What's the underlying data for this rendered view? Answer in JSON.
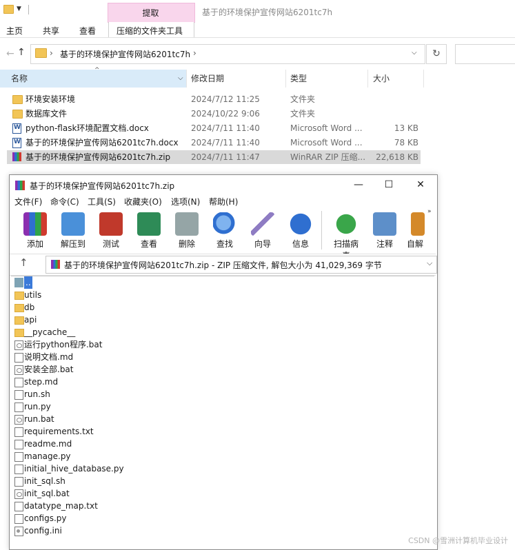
{
  "explorer": {
    "window_title": "基于的环境保护宣传网站6201tc7h",
    "context_tab": "提取",
    "tabs": [
      "主页",
      "共享",
      "查看",
      "压缩的文件夹工具"
    ],
    "address": "基于的环境保护宣传网站6201tc7h",
    "columns": [
      "名称",
      "修改日期",
      "类型",
      "大小"
    ],
    "files": [
      {
        "name": "环境安装环境",
        "date": "2024/7/12 11:25",
        "type": "文件夹",
        "size": "",
        "icon": "folder-icon"
      },
      {
        "name": "数据库文件",
        "date": "2024/10/22 9:06",
        "type": "文件夹",
        "size": "",
        "icon": "folder-icon"
      },
      {
        "name": "python-flask环境配置文档.docx",
        "date": "2024/7/11 11:40",
        "type": "Microsoft Word ...",
        "size": "13 KB",
        "icon": "word-doc-icon"
      },
      {
        "name": "基于的环境保护宣传网站6201tc7h.docx",
        "date": "2024/7/11 11:40",
        "type": "Microsoft Word ...",
        "size": "78 KB",
        "icon": "word-doc-icon"
      },
      {
        "name": "基于的环境保护宣传网站6201tc7h.zip",
        "date": "2024/7/11 11:47",
        "type": "WinRAR ZIP 压缩...",
        "size": "22,618 KB",
        "icon": "winrar-archive-icon",
        "selected": true
      }
    ]
  },
  "winrar": {
    "title": "基于的环境保护宣传网站6201tc7h.zip",
    "window_controls": [
      "—",
      "☐",
      "✕"
    ],
    "menu": [
      "文件(F)",
      "命令(C)",
      "工具(S)",
      "收藏夹(O)",
      "选项(N)",
      "帮助(H)"
    ],
    "toolbar": [
      {
        "label": "添加",
        "icon": "add-archive-icon",
        "color": "#c8622a"
      },
      {
        "label": "解压到",
        "icon": "extract-folder-icon",
        "color": "#4a90d9"
      },
      {
        "label": "测试",
        "icon": "test-clipboard-icon",
        "color": "#c0392b"
      },
      {
        "label": "查看",
        "icon": "view-book-icon",
        "color": "#2e8b57"
      },
      {
        "label": "删除",
        "icon": "delete-trash-icon",
        "color": "#7f8c8d"
      },
      {
        "label": "查找",
        "icon": "find-magnifier-icon",
        "color": "#2f6fd0"
      },
      {
        "label": "向导",
        "icon": "wizard-wand-icon",
        "color": "#8e7cc3"
      },
      {
        "label": "信息",
        "icon": "info-icon",
        "color": "#2f6fd0"
      },
      {
        "label": "扫描病毒",
        "icon": "scan-virus-icon",
        "color": "#3aa64a"
      },
      {
        "label": "注释",
        "icon": "comment-icon",
        "color": "#5d8fc9"
      },
      {
        "label": "自解",
        "icon": "sfx-icon",
        "color": "#d4892a"
      }
    ],
    "more_glyph": "»",
    "address": "基于的环境保护宣传网站6201tc7h.zip - ZIP 压缩文件, 解包大小为 41,029,369 字节",
    "items": [
      {
        "name": "..",
        "type": "up",
        "selected": true
      },
      {
        "name": "utils",
        "type": "folder"
      },
      {
        "name": "db",
        "type": "folder"
      },
      {
        "name": "api",
        "type": "folder"
      },
      {
        "name": "__pycache__",
        "type": "folder"
      },
      {
        "name": "运行python程序.bat",
        "type": "bat"
      },
      {
        "name": "说明文档.md",
        "type": "file"
      },
      {
        "name": "安装全部.bat",
        "type": "bat"
      },
      {
        "name": "step.md",
        "type": "file"
      },
      {
        "name": "run.sh",
        "type": "file"
      },
      {
        "name": "run.py",
        "type": "file"
      },
      {
        "name": "run.bat",
        "type": "bat"
      },
      {
        "name": "requirements.txt",
        "type": "file"
      },
      {
        "name": "readme.md",
        "type": "file"
      },
      {
        "name": "manage.py",
        "type": "file"
      },
      {
        "name": "initial_hive_database.py",
        "type": "file"
      },
      {
        "name": "init_sql.sh",
        "type": "file"
      },
      {
        "name": "init_sql.bat",
        "type": "bat"
      },
      {
        "name": "datatype_map.txt",
        "type": "file"
      },
      {
        "name": "configs.py",
        "type": "file"
      },
      {
        "name": "config.ini",
        "type": "ini"
      }
    ]
  },
  "watermark": "CSDN @雪洲计算机毕业设计"
}
